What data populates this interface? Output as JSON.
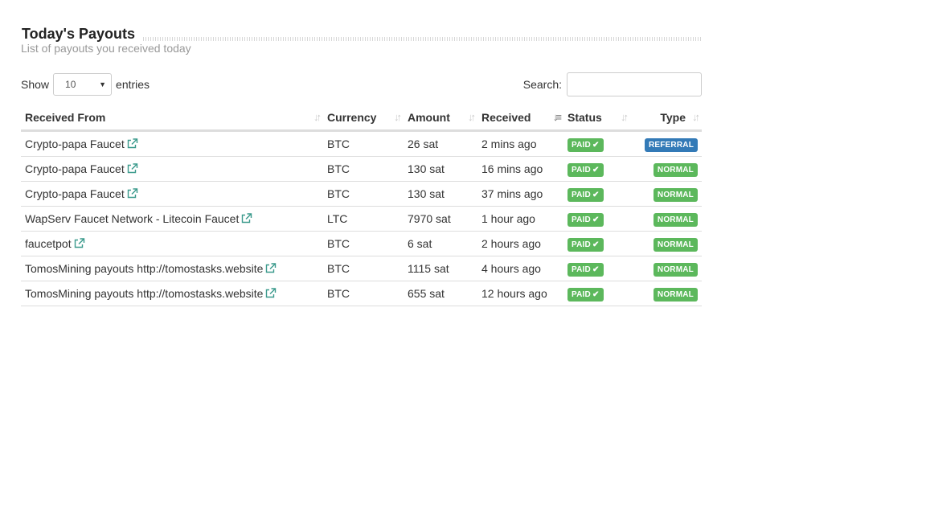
{
  "panel": {
    "title": "Today's Payouts",
    "subtitle": "List of payouts you received today"
  },
  "controls": {
    "show_label": "Show",
    "entries_value": "10",
    "entries_label": "entries",
    "search_label": "Search:",
    "search_value": ""
  },
  "table": {
    "columns": [
      "Received From",
      "Currency",
      "Amount",
      "Received",
      "Status",
      "Type"
    ],
    "sorted_column": "Received",
    "rows": [
      {
        "from": "Crypto-papa Faucet",
        "currency": "BTC",
        "amount": "26 sat",
        "received": "2 mins ago",
        "status": "PAID",
        "type": "REFERRAL"
      },
      {
        "from": "Crypto-papa Faucet",
        "currency": "BTC",
        "amount": "130 sat",
        "received": "16 mins ago",
        "status": "PAID",
        "type": "NORMAL"
      },
      {
        "from": "Crypto-papa Faucet",
        "currency": "BTC",
        "amount": "130 sat",
        "received": "37 mins ago",
        "status": "PAID",
        "type": "NORMAL"
      },
      {
        "from": "WapServ Faucet Network - Litecoin Faucet",
        "currency": "LTC",
        "amount": "7970 sat",
        "received": "1 hour ago",
        "status": "PAID",
        "type": "NORMAL"
      },
      {
        "from": "faucetpot",
        "currency": "BTC",
        "amount": "6 sat",
        "received": "2 hours ago",
        "status": "PAID",
        "type": "NORMAL"
      },
      {
        "from": "TomosMining payouts http://tomostasks.website",
        "currency": "BTC",
        "amount": "1115 sat",
        "received": "4 hours ago",
        "status": "PAID",
        "type": "NORMAL"
      },
      {
        "from": "TomosMining payouts http://tomostasks.website",
        "currency": "BTC",
        "amount": "655 sat",
        "received": "12 hours ago",
        "status": "PAID",
        "type": "NORMAL"
      }
    ]
  },
  "colors": {
    "link_icon": "#3a9a8c",
    "paid": "#5cb85c",
    "normal": "#5cb85c",
    "referral": "#337ab7"
  },
  "icons": {
    "external_link": "external-link-icon",
    "check": "check-icon",
    "sort": "sort-icon",
    "dropdown": "chevron-down-icon"
  }
}
